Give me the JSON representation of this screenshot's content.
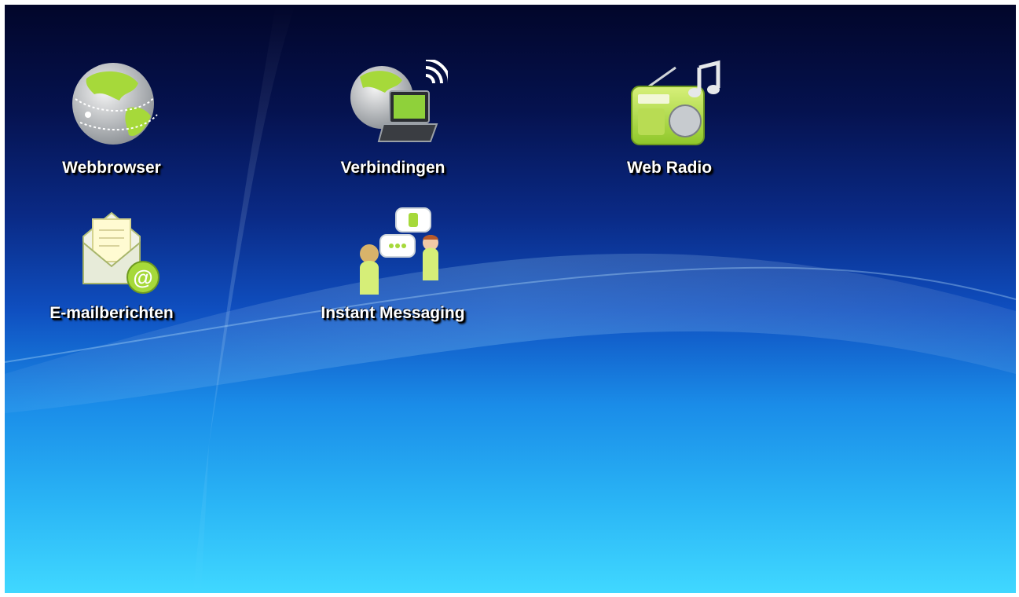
{
  "desktop": {
    "apps": [
      {
        "label": "Webbrowser",
        "icon": "globe-icon"
      },
      {
        "label": "Verbindingen",
        "icon": "laptop-wifi-icon"
      },
      {
        "label": "Web Radio",
        "icon": "radio-icon"
      },
      {
        "label": "E-mailberichten",
        "icon": "envelope-at-icon"
      },
      {
        "label": "Instant Messaging",
        "icon": "chat-people-icon"
      }
    ]
  },
  "colors": {
    "accent_green": "#a6d93a",
    "background_top": "#02062a",
    "background_bottom": "#40d8ff"
  }
}
